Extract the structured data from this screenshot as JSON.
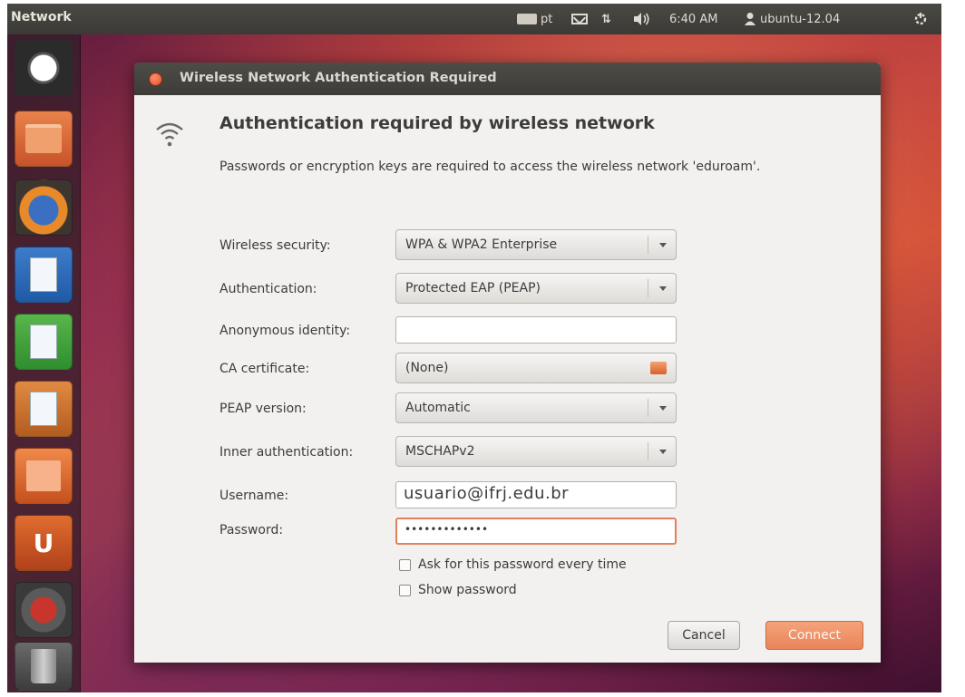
{
  "top_panel": {
    "app_title": "Network",
    "keyboard_layout": "pt",
    "time": "6:40 AM",
    "user": "ubuntu-12.04",
    "icons": [
      "keyboard-icon",
      "mail-icon",
      "network-arrows-icon",
      "volume-icon",
      "user-icon",
      "power-gear-icon"
    ]
  },
  "launcher": {
    "items": [
      "dash-home",
      "files",
      "firefox",
      "libreoffice-writer",
      "libreoffice-calc",
      "libreoffice-impress",
      "software-center",
      "ubuntu-one",
      "system-settings",
      "trash"
    ]
  },
  "dialog": {
    "title": "Wireless Network Authentication Required",
    "heading": "Authentication required by wireless network",
    "description": "Passwords or encryption keys are required to access the wireless network 'eduroam'.",
    "fields": {
      "wireless_security": {
        "label": "Wireless security:",
        "value": "WPA & WPA2 Enterprise"
      },
      "authentication": {
        "label": "Authentication:",
        "value": "Protected EAP (PEAP)"
      },
      "anonymous_identity": {
        "label": "Anonymous identity:",
        "value": ""
      },
      "ca_certificate": {
        "label": "CA certificate:",
        "value": "(None)"
      },
      "peap_version": {
        "label": "PEAP version:",
        "value": "Automatic"
      },
      "inner_authentication": {
        "label": "Inner authentication:",
        "value": "MSCHAPv2"
      },
      "username": {
        "label": "Username:",
        "value": "usuario@ifrj.edu.br"
      },
      "password": {
        "label": "Password:",
        "value": "•••••••••••••"
      }
    },
    "checkboxes": {
      "ask_every_time": {
        "label": "Ask for this password every time",
        "checked": false
      },
      "show_password": {
        "label": "Show password",
        "checked": false
      }
    },
    "buttons": {
      "cancel": "Cancel",
      "connect": "Connect"
    }
  },
  "colors": {
    "accent": "#e9855a",
    "panel": "#3b3a36",
    "dialog_body": "#f2f1f0"
  }
}
